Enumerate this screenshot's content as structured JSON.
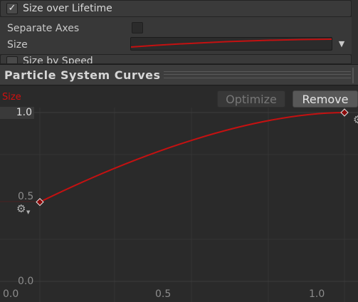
{
  "colors": {
    "curve": "#c41111",
    "curve_name": "#d01010",
    "background": "#2a2a2a",
    "panel": "#383838"
  },
  "module": {
    "title": "Size over Lifetime",
    "enabled": true,
    "check_glyph": "✓",
    "separate_axes_label": "Separate Axes",
    "separate_axes_checked": false,
    "size_label": "Size",
    "dropdown_icon": "chevron-down-icon",
    "dropdown_glyph": "▼"
  },
  "next_module": {
    "title": "Size by Speed"
  },
  "curves_window": {
    "title": "Particle System Curves"
  },
  "editor": {
    "curve_name": "Size",
    "optimize_label": "Optimize",
    "remove_label": "Remove",
    "y_labels": {
      "top": "1.0",
      "mid": "0.5",
      "bottom": "0.0"
    },
    "x_labels": {
      "start": "0.0",
      "mid": "0.5",
      "end": "1.0"
    },
    "gear_glyph": "⚙",
    "caret_glyph": "▼"
  },
  "curve": {
    "keys": [
      {
        "time": 0.0,
        "value": 0.47
      },
      {
        "time": 1.0,
        "value": 1.0
      }
    ]
  }
}
